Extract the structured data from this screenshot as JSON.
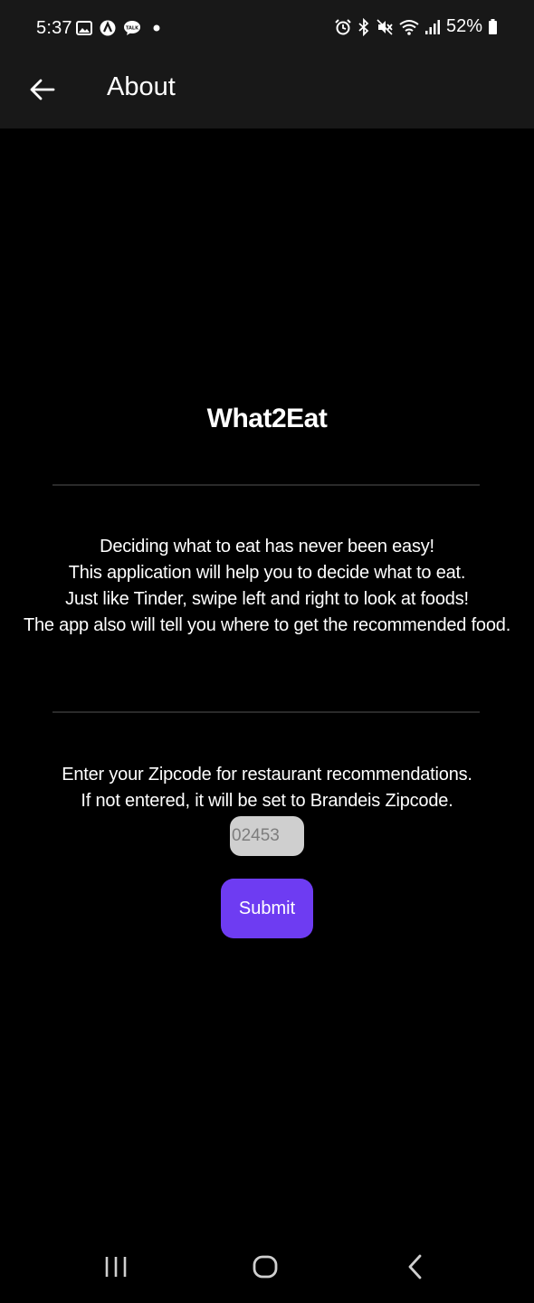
{
  "status_bar": {
    "time": "5:37",
    "battery": "52%",
    "left_icons": [
      "gallery-icon",
      "app-a-icon",
      "talk-icon",
      "dot-icon"
    ],
    "right_icons": [
      "alarm-icon",
      "bluetooth-icon",
      "mute-icon",
      "wifi-icon",
      "signal-icon",
      "battery-icon"
    ]
  },
  "app_bar": {
    "title": "About",
    "back_icon": "arrow-left-icon"
  },
  "main": {
    "app_name": "What2Eat",
    "description_lines": [
      "Deciding what to eat has never been easy!",
      "This application will help you to decide what to eat.",
      "Just like Tinder, swipe left and right to look at foods!",
      "The app also will tell you where to get the recommended food."
    ],
    "zip_prompt_lines": [
      "Enter your Zipcode for restaurant recommendations.",
      "If not entered, it will be set to Brandeis Zipcode."
    ],
    "zip_input": {
      "value": "",
      "placeholder": "02453"
    },
    "submit_label": "Submit"
  },
  "nav_bar": {
    "items": [
      "recents-icon",
      "home-icon",
      "back-icon"
    ]
  },
  "colors": {
    "background": "#000000",
    "bar_background": "#181818",
    "accent": "#6e3cf2",
    "input_background": "#cfcfcf"
  }
}
